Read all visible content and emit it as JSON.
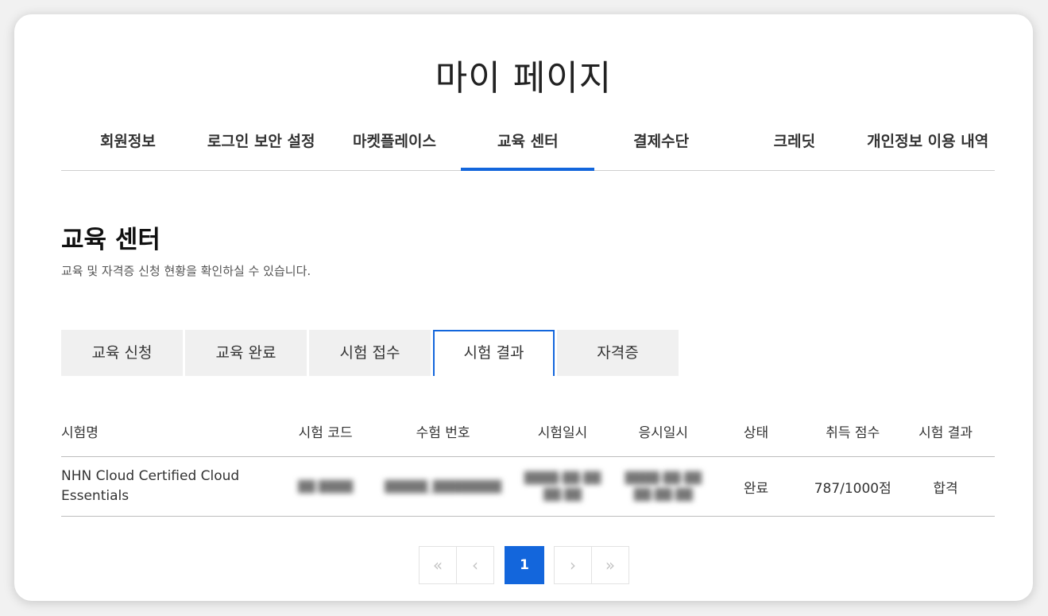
{
  "header": {
    "title": "마이 페이지"
  },
  "main_tabs": [
    {
      "label": "회원정보",
      "active": false
    },
    {
      "label": "로그인 보안 설정",
      "active": false
    },
    {
      "label": "마켓플레이스",
      "active": false
    },
    {
      "label": "교육 센터",
      "active": true
    },
    {
      "label": "결제수단",
      "active": false
    },
    {
      "label": "크레딧",
      "active": false
    },
    {
      "label": "개인정보 이용 내역",
      "active": false
    }
  ],
  "section": {
    "title": "교육 센터",
    "description": "교육 및 자격증 신청 현황을 확인하실 수 있습니다."
  },
  "sub_tabs": [
    {
      "label": "교육 신청",
      "active": false
    },
    {
      "label": "교육 완료",
      "active": false
    },
    {
      "label": "시험 접수",
      "active": false
    },
    {
      "label": "시험 결과",
      "active": true
    },
    {
      "label": "자격증",
      "active": false
    }
  ],
  "table": {
    "headers": {
      "name": "시험명",
      "code": "시험 코드",
      "number": "수험 번호",
      "exam_date": "시험일시",
      "apply_date": "응시일시",
      "status": "상태",
      "score": "취득 점수",
      "result": "시험 결과"
    },
    "rows": [
      {
        "name": "NHN Cloud Certified Cloud Essentials",
        "code": "",
        "number": "",
        "exam_date": "",
        "apply_date": "",
        "status": "완료",
        "score": "787/1000점",
        "result": "합격"
      }
    ]
  },
  "pagination": {
    "first_icon": "double-chevron-left-icon",
    "prev_icon": "chevron-left-icon",
    "current_page": "1",
    "next_icon": "chevron-right-icon",
    "last_icon": "double-chevron-right-icon"
  },
  "colors": {
    "accent": "#1366dc",
    "tab_bg": "#f0f0f0"
  }
}
